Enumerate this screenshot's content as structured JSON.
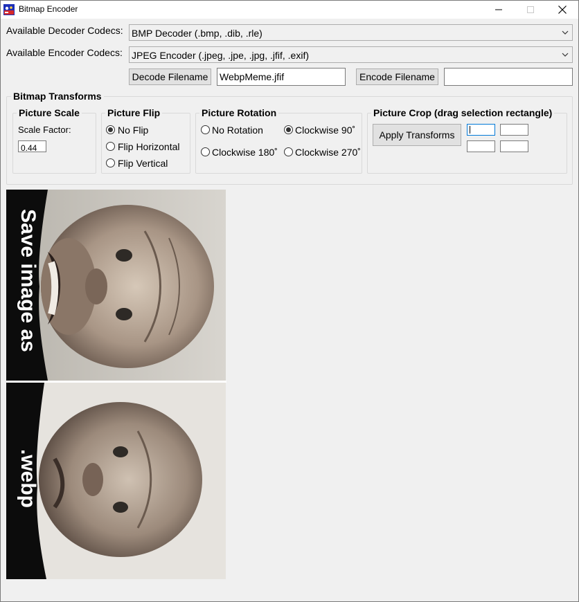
{
  "window": {
    "title": "Bitmap Encoder",
    "icon": "bitmap-app-icon"
  },
  "decoder": {
    "label": "Available Decoder Codecs:",
    "selected": "BMP Decoder (.bmp, .dib, .rle)"
  },
  "encoder": {
    "label": "Available Encoder Codecs:",
    "selected": "JPEG Encoder (.jpeg, .jpe, .jpg, .jfif, .exif)"
  },
  "files": {
    "decode_button": "Decode Filename",
    "decode_value": "WebpMeme.jfif",
    "encode_button": "Encode Filename",
    "encode_value": ""
  },
  "transforms": {
    "group_title": "Bitmap Transforms",
    "scale": {
      "title": "Picture Scale",
      "factor_label": "Scale Factor:",
      "factor_value": "0.44"
    },
    "flip": {
      "title": "Picture Flip",
      "options": [
        {
          "label": "No Flip",
          "checked": true
        },
        {
          "label": "Flip Horizontal",
          "checked": false
        },
        {
          "label": "Flip Vertical",
          "checked": false
        }
      ]
    },
    "rotation": {
      "title": "Picture Rotation",
      "options": [
        {
          "label": "No Rotation",
          "checked": false
        },
        {
          "label": "Clockwise 90˚",
          "checked": true
        },
        {
          "label": "Clockwise 180˚",
          "checked": false
        },
        {
          "label": "Clockwise 270˚",
          "checked": false
        }
      ]
    },
    "crop": {
      "title": "Picture Crop (drag selection rectangle)",
      "apply_button": "Apply Transforms",
      "fields": [
        "",
        "",
        "",
        ""
      ]
    }
  },
  "preview": {
    "caption_top": "Save image as",
    "caption_bottom": ".webp"
  },
  "colors": {
    "window_bg": "#f0f0f0",
    "titlebar_bg": "#ffffff",
    "focus_border": "#0078d7"
  }
}
